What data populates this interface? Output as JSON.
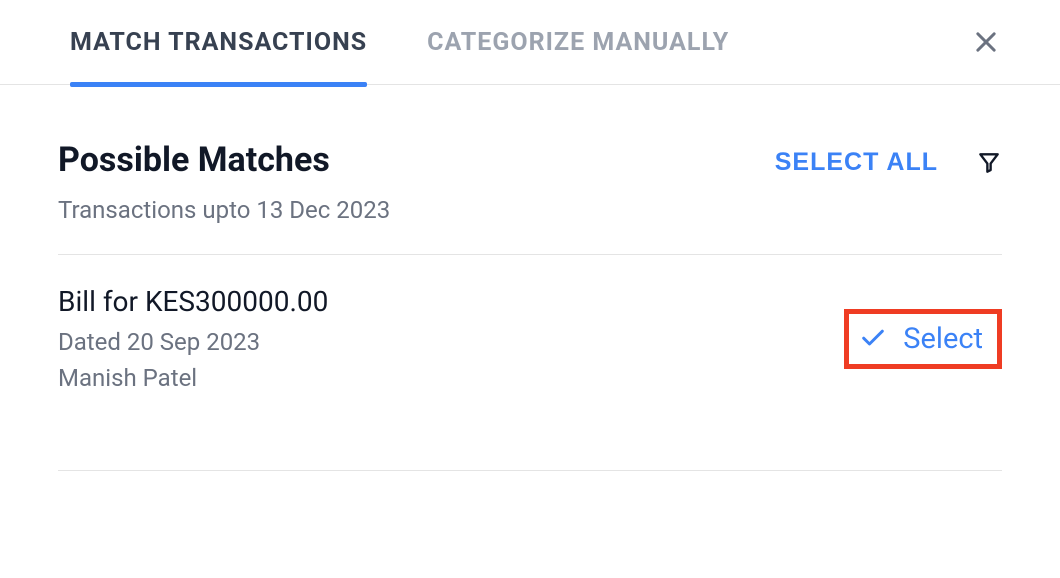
{
  "tabs": {
    "match": "MATCH TRANSACTIONS",
    "categorize": "CATEGORIZE MANUALLY"
  },
  "header": {
    "title": "Possible Matches",
    "subtitle": "Transactions upto 13 Dec 2023",
    "select_all_label": "SELECT ALL"
  },
  "match": {
    "title": "Bill for KES300000.00",
    "date": "Dated  20 Sep 2023",
    "person": "Manish Patel",
    "select_label": "Select"
  }
}
